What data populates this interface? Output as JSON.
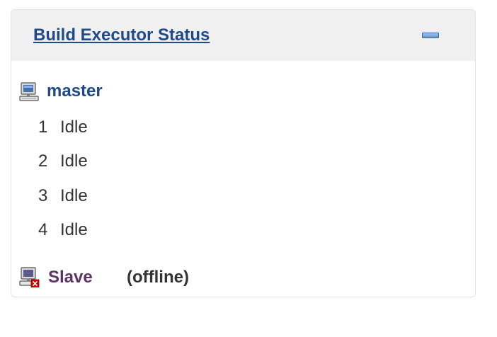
{
  "panel": {
    "title": "Build Executor Status",
    "collapse_icon": "minus-icon"
  },
  "nodes": {
    "master": {
      "name": "master",
      "icon": "computer-icon",
      "executors": [
        {
          "number": "1",
          "status": "Idle"
        },
        {
          "number": "2",
          "status": "Idle"
        },
        {
          "number": "3",
          "status": "Idle"
        },
        {
          "number": "4",
          "status": "Idle"
        }
      ]
    },
    "slave": {
      "name": "Slave",
      "icon": "computer-offline-icon",
      "status": "(offline)"
    }
  },
  "colors": {
    "header_bg": "#f0f0f0",
    "link_blue": "#204a87",
    "link_visited": "#5c3566",
    "text": "#333333",
    "offline_badge": "#cc0000"
  }
}
